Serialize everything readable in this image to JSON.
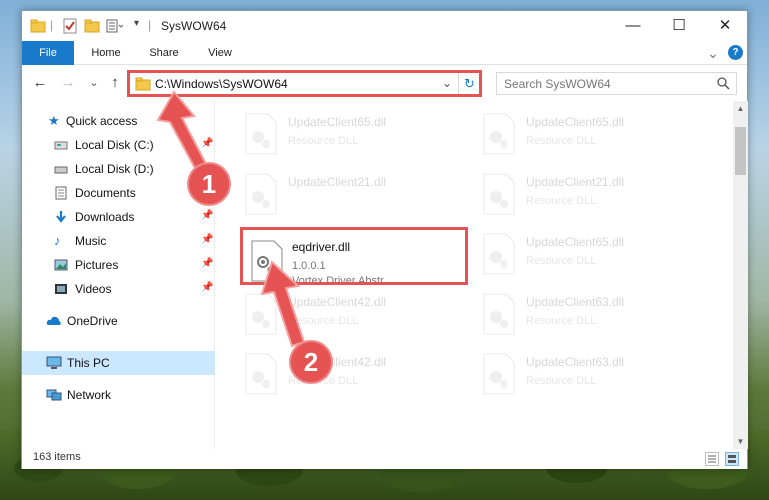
{
  "window": {
    "title": "SysWOW64",
    "minimize": "—",
    "maximize": "☐",
    "close": "✕"
  },
  "ribbon": {
    "tabs": [
      "File",
      "Home",
      "Share",
      "View"
    ],
    "chevron": "⌄",
    "help": "?"
  },
  "navigation": {
    "back": "←",
    "forward": "→",
    "recent": "⌄",
    "up": "↑",
    "address": "C:\\Windows\\SysWOW64",
    "address_dropdown": "⌄",
    "refresh": "↻",
    "search_placeholder": "Search SysWOW64"
  },
  "sidebar": {
    "items": [
      {
        "label": "Quick access",
        "icon": "star-icon",
        "pinned": false
      },
      {
        "label": "Local Disk (C:)",
        "icon": "drive-icon",
        "pinned": true
      },
      {
        "label": "Local Disk (D:)",
        "icon": "drive-icon",
        "pinned": false
      },
      {
        "label": "Documents",
        "icon": "documents-icon",
        "pinned": true
      },
      {
        "label": "Downloads",
        "icon": "download-icon",
        "pinned": true
      },
      {
        "label": "Music",
        "icon": "music-icon",
        "pinned": true
      },
      {
        "label": "Pictures",
        "icon": "pictures-icon",
        "pinned": true
      },
      {
        "label": "Videos",
        "icon": "videos-icon",
        "pinned": true
      },
      {
        "label": "OneDrive",
        "icon": "cloud-icon",
        "pinned": false
      },
      {
        "label": "This PC",
        "icon": "computer-icon",
        "pinned": false,
        "selected": true
      },
      {
        "label": "Network",
        "icon": "network-icon",
        "pinned": false
      }
    ]
  },
  "files": [
    {
      "name": "UpdateClient65.dll",
      "sub": "Resource DLL",
      "faded": true
    },
    {
      "name": "UpdateClient65.dll",
      "sub": "Resource DLL",
      "faded": true
    },
    {
      "name": "UpdateClient21.dll",
      "sub": "",
      "faded": true
    },
    {
      "name": "UpdateClient21.dll",
      "sub": "Resource DLL",
      "faded": true
    },
    {
      "name": "eqdriver.dll",
      "sub": "1.0.0.1",
      "sub2": "Vortex Driver Abstr...",
      "faded": false
    },
    {
      "name": "UpdateClient65.dll",
      "sub": "Resource DLL",
      "faded": true
    },
    {
      "name": "UpdateClient42.dll",
      "sub": "Resource DLL",
      "faded": true
    },
    {
      "name": "UpdateClient63.dll",
      "sub": "Resource DLL",
      "faded": true
    },
    {
      "name": "UpdateClient42.dll",
      "sub": "Resource DLL",
      "faded": true
    },
    {
      "name": "UpdateClient63.dll",
      "sub": "Resource DLL",
      "faded": true
    }
  ],
  "status": {
    "item_count": "163 items"
  },
  "annotations": {
    "step1": "1",
    "step2": "2",
    "color": "#e55353"
  },
  "colors": {
    "accent": "#1979ca",
    "selection": "#cce8ff",
    "highlight": "#e55353"
  }
}
